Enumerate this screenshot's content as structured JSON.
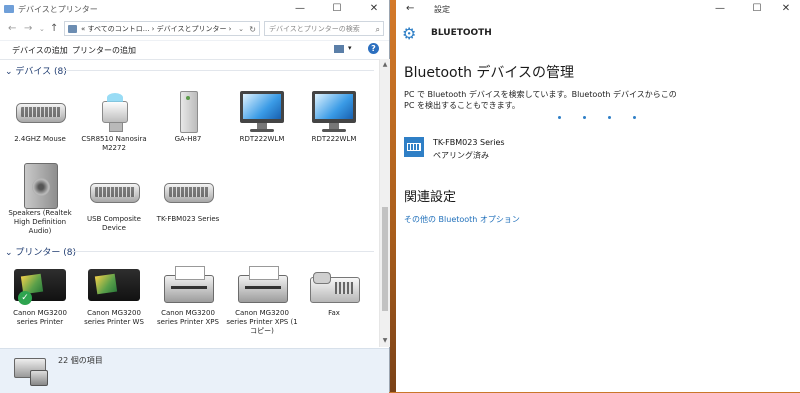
{
  "left_window": {
    "title": "デバイスとプリンター",
    "controls": {
      "minimize": "—",
      "maximize": "☐",
      "close": "✕"
    },
    "nav": {
      "back": "←",
      "forward": "→",
      "dropdown": "⌄",
      "up": "↑"
    },
    "address": {
      "path": "« すべてのコントロ... › デバイスとプリンター ›",
      "dropdown": "⌄",
      "refresh": "↻"
    },
    "search": {
      "placeholder": "デバイスとプリンターの検索",
      "icon": "search-icon"
    },
    "commands": {
      "add_device": "デバイスの追加",
      "add_printer": "プリンターの追加",
      "view_drop": "▾",
      "help": "?"
    },
    "groups": {
      "devices": {
        "header": "デバイス (8)",
        "items": [
          {
            "label": "2.4GHZ Mouse",
            "icon": "keyboard-icon"
          },
          {
            "label": "CSR8510 Nanosira M2272",
            "icon": "usb-dongle-icon"
          },
          {
            "label": "GA-H87",
            "icon": "pc-tower-icon"
          },
          {
            "label": "RDT222WLM",
            "icon": "monitor-icon"
          },
          {
            "label": "RDT222WLM",
            "icon": "monitor-icon"
          },
          {
            "label": "Speakers (Realtek High Definition Audio)",
            "icon": "speaker-icon"
          },
          {
            "label": "USB Composite Device",
            "icon": "keyboard-icon"
          },
          {
            "label": "TK-FBM023 Series",
            "icon": "keyboard-icon"
          }
        ]
      },
      "printers": {
        "header": "プリンター (8)",
        "items": [
          {
            "label": "Canon MG3200 series Printer",
            "icon": "inkjet-printer-icon",
            "default": true
          },
          {
            "label": "Canon MG3200 series Printer WS",
            "icon": "inkjet-printer-icon"
          },
          {
            "label": "Canon MG3200 series Printer XPS",
            "icon": "printer-icon"
          },
          {
            "label": "Canon MG3200 series Printer XPS (1 コピー)",
            "icon": "printer-icon"
          },
          {
            "label": "Fax",
            "icon": "fax-icon"
          }
        ]
      }
    },
    "scrollbar": {
      "up": "▲",
      "down": "▼"
    },
    "details": {
      "count": "22 個の項目"
    }
  },
  "right_window": {
    "title": "設定",
    "back": "←",
    "controls": {
      "minimize": "—",
      "maximize": "☐",
      "close": "✕"
    },
    "header": "BLUETOOTH",
    "heading": "Bluetooth デバイスの管理",
    "description": "PC で Bluetooth デバイスを検索しています。Bluetooth デバイスからこの PC を検出することもできます。",
    "device": {
      "name": "TK-FBM023 Series",
      "status": "ペアリング済み"
    },
    "related_heading": "関連設定",
    "related_link": "その他の Bluetooth オプション",
    "accent_color": "#2f7fc6"
  },
  "desktop_color": "#c9772a"
}
